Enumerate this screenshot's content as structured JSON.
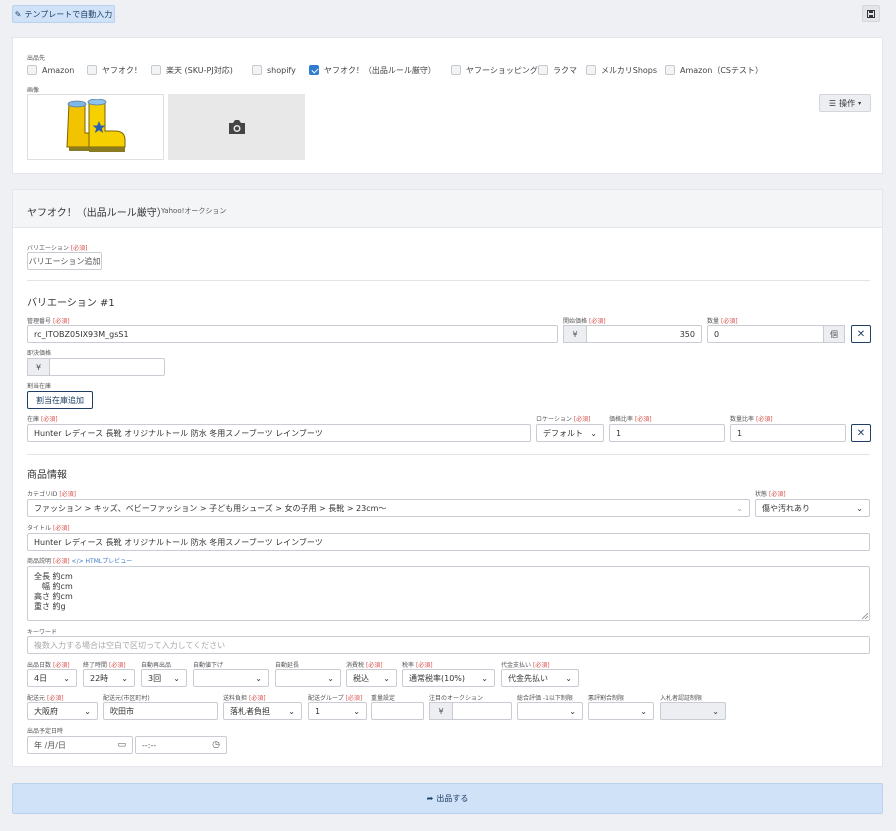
{
  "toolbar": {
    "template_button": "テンプレートで自動入力"
  },
  "marketplaces": {
    "label": "出品先",
    "items": [
      {
        "name": "Amazon",
        "checked": false
      },
      {
        "name": "ヤフオク！",
        "checked": false
      },
      {
        "name": "楽天 (SKU-PJ対応)",
        "checked": false
      },
      {
        "name": "shopify",
        "checked": false
      },
      {
        "name": "ヤフオク！（出品ルール厳守）",
        "checked": true
      },
      {
        "name": "ヤフーショッピング",
        "checked": false
      },
      {
        "name": "ラクマ",
        "checked": false
      },
      {
        "name": "メルカリShops",
        "checked": false
      },
      {
        "name": "Amazon（CSテスト）",
        "checked": false
      }
    ]
  },
  "images": {
    "label": "画像",
    "actions_button": "操作"
  },
  "section": {
    "title": "ヤフオク！（出品ルール厳守）",
    "subtitle": "Yahoo!オークション"
  },
  "req": "[必須]",
  "variation": {
    "label": "バリエーション",
    "add_button": "バリエーション追加",
    "heading": "バリエーション #1",
    "sku_label": "管理番号",
    "sku_value": "rc_ITOBZ05IX93M_gsS1",
    "start_price_label": "開始価格",
    "currency": "¥",
    "start_price_value": "350",
    "quantity_label": "数量",
    "quantity_value": "0",
    "quantity_unit": "個",
    "buyout_label": "即決価格",
    "buyout_currency": "¥",
    "alloc_label": "割当在庫",
    "alloc_button": "割当在庫追加",
    "stock_label": "在庫",
    "stock_value": "Hunter レディース 長靴 オリジナルトール 防水 冬用スノーブーツ レインブーツ",
    "rotation_label": "ロケーション",
    "rotation_value": "デフォルト",
    "price_ratio_label": "価格比率",
    "price_ratio_value": "1",
    "qty_ratio_label": "数量比率",
    "qty_ratio_value": "1"
  },
  "product": {
    "heading": "商品情報",
    "category_label": "カテゴリID",
    "category_value": "ファッション > キッズ、ベビーファッション > 子ども用シューズ > 女の子用 > 長靴 > 23cm〜",
    "condition_label": "状態",
    "condition_value": "傷や汚れあり",
    "title_label": "タイトル",
    "title_value": "Hunter レディース 長靴 オリジナルトール 防水 冬用スノーブーツ レインブーツ",
    "desc_label": "商品説明",
    "desc_preview": "</> HTMLプレビュー",
    "desc_lines": [
      "全長 約cm",
      "　幅 約cm",
      "高さ 約cm",
      "重さ 約g"
    ],
    "keyword_label": "キーワード",
    "keyword_placeholder": "複数入力する場合は空白で区切って入力してください"
  },
  "shipping": {
    "duration_label": "出品日数",
    "duration_value": "4日",
    "end_time_label": "終了時間",
    "end_time_value": "22時",
    "relist_label": "自動再出品",
    "relist_value": "3回",
    "auto_discount_label": "自動値下げ",
    "auto_extend_label": "自動延長",
    "tax_label": "消費税",
    "tax_value": "税込",
    "tax_rate_label": "税率",
    "tax_rate_value": "通常税率(10%)",
    "cod_label": "代金支払い",
    "cod_value": "代金先払い",
    "pref_label": "配送元",
    "pref_value": "大阪府",
    "city_label": "配送元(市区町村)",
    "city_value": "吹田市",
    "ship_fee_label": "送料負担",
    "ship_fee_value": "落札者負担",
    "ship_group_label": "配送グループ",
    "ship_group_value": "1",
    "weight_label": "重量設定",
    "featured_label": "注目のオークション",
    "featured_currency": "¥",
    "rating_label": "総合評価 -1以下制限",
    "bad_rating_label": "悪評割合制限",
    "bidder_auth_label": "入札者認証制限",
    "schedule_label": "出品予定日時",
    "date_placeholder": "年 /月/日",
    "time_placeholder": "--:--"
  },
  "submit": {
    "label": "出品する"
  }
}
